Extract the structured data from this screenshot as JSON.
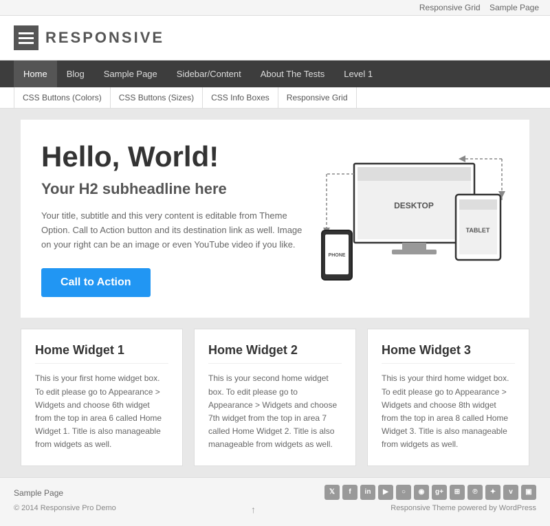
{
  "topbar": {
    "links": [
      "Responsive Grid",
      "Sample Page"
    ]
  },
  "header": {
    "logo_text": "RESPONSIVE"
  },
  "main_nav": {
    "items": [
      {
        "label": "Home",
        "active": true
      },
      {
        "label": "Blog",
        "active": false
      },
      {
        "label": "Sample Page",
        "active": false
      },
      {
        "label": "Sidebar/Content",
        "active": false
      },
      {
        "label": "About The Tests",
        "active": false
      },
      {
        "label": "Level 1",
        "active": false
      }
    ]
  },
  "sub_nav": {
    "items": [
      {
        "label": "CSS Buttons (Colors)"
      },
      {
        "label": "CSS Buttons (Sizes)"
      },
      {
        "label": "CSS Info Boxes"
      },
      {
        "label": "Responsive Grid"
      }
    ]
  },
  "hero": {
    "h1": "Hello, World!",
    "h2": "Your H2 subheadline here",
    "description": "Your title, subtitle and this very content is editable from Theme Option. Call to Action button and its destination link as well. Image on your right can be an image or even YouTube video if you like.",
    "cta_label": "Call to Action",
    "desktop_label": "DESKTOP",
    "tablet_label": "TABLET",
    "phone_label": "PHONE"
  },
  "widgets": [
    {
      "title": "Home Widget 1",
      "text": "This is your first home widget box. To edit please go to Appearance > Widgets and choose 6th widget from the top in area 6 called Home Widget 1. Title is also manageable from widgets as well."
    },
    {
      "title": "Home Widget 2",
      "text": "This is your second home widget box. To edit please go to Appearance > Widgets and choose 7th widget from the top in area 7 called Home Widget 2. Title is also manageable from widgets as well."
    },
    {
      "title": "Home Widget 3",
      "text": "This is your third home widget box. To edit please go to Appearance > Widgets and choose 8th widget from the top in area 8 called Home Widget 3. Title is also manageable from widgets as well."
    }
  ],
  "footer": {
    "link_label": "Sample Page",
    "icons": [
      "f",
      "f",
      "in",
      "y",
      "o",
      "rss",
      "g+",
      "wp",
      "p",
      "l",
      "v",
      "vi"
    ],
    "icon_symbols": [
      "𝕏",
      "f",
      "in",
      "▶",
      "○",
      "◎",
      "g+",
      "⊞",
      "℗",
      "❋",
      "v",
      "▣"
    ],
    "copyright": "© 2014 Responsive Pro Demo",
    "powered_by": "Responsive Theme powered by WordPress",
    "arrow_up": "↑"
  }
}
